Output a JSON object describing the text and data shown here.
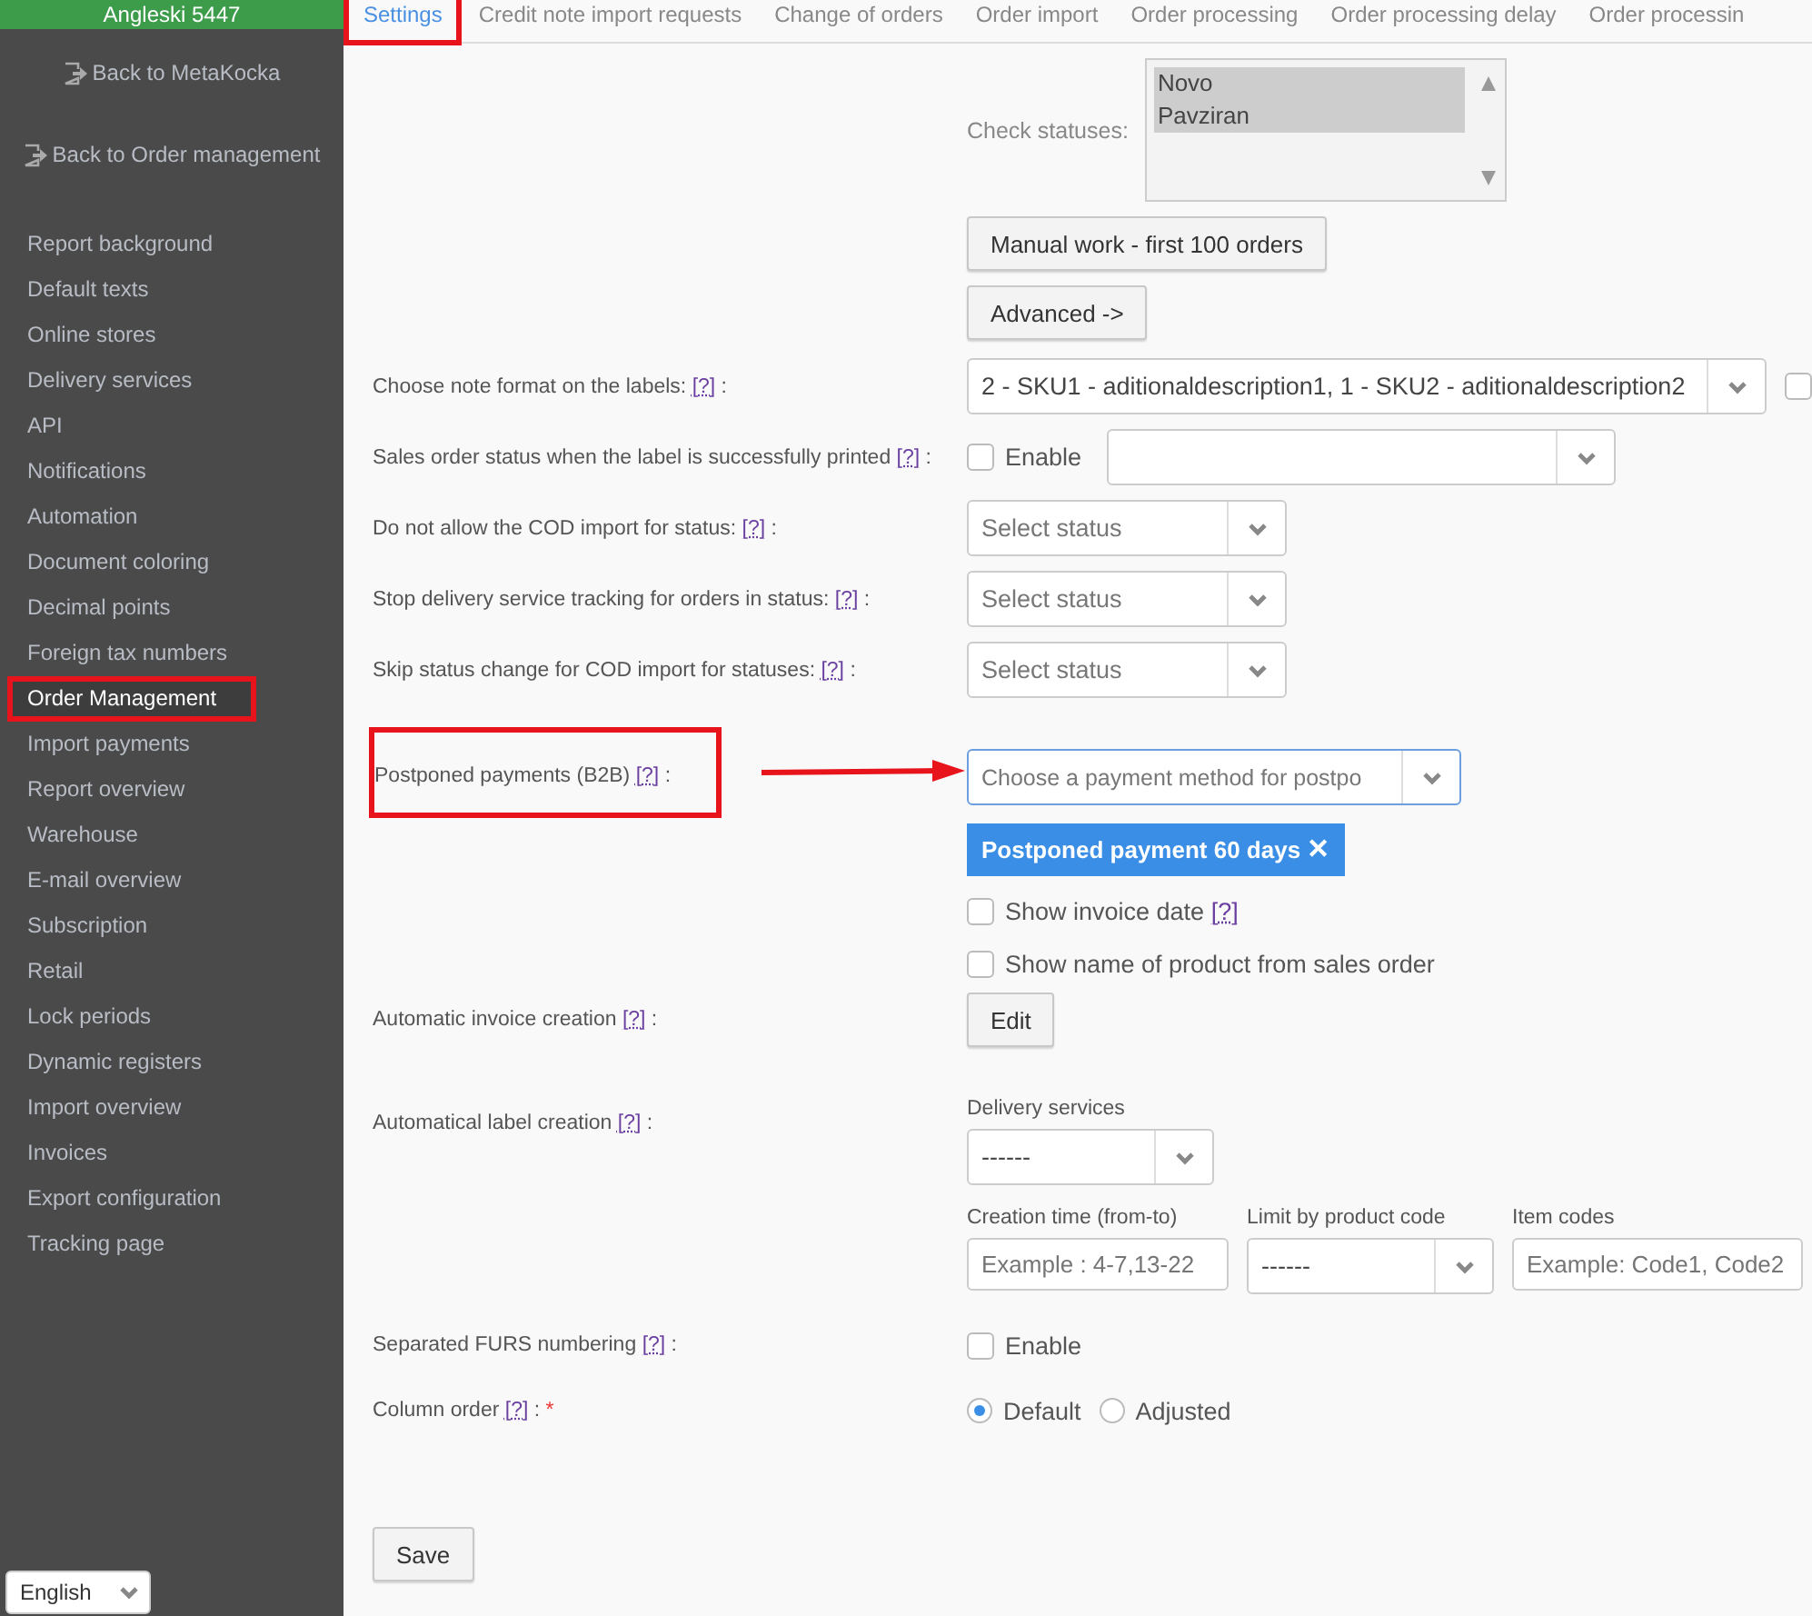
{
  "sidebar": {
    "header": "Angleski 5447",
    "back_links": [
      {
        "label": "Back to MetaKocka"
      },
      {
        "label": "Back to Order management"
      }
    ],
    "items": [
      {
        "label": "Report background",
        "selected": false,
        "highlighted": false
      },
      {
        "label": "Default texts",
        "selected": false,
        "highlighted": false
      },
      {
        "label": "Online stores",
        "selected": false,
        "highlighted": false
      },
      {
        "label": "Delivery services",
        "selected": false,
        "highlighted": false
      },
      {
        "label": "API",
        "selected": false,
        "highlighted": false
      },
      {
        "label": "Notifications",
        "selected": false,
        "highlighted": false
      },
      {
        "label": "Automation",
        "selected": false,
        "highlighted": false
      },
      {
        "label": "Document coloring",
        "selected": false,
        "highlighted": false
      },
      {
        "label": "Decimal points",
        "selected": false,
        "highlighted": false
      },
      {
        "label": "Foreign tax numbers",
        "selected": false,
        "highlighted": false
      },
      {
        "label": "Order Management",
        "selected": true,
        "highlighted": true
      },
      {
        "label": "Import payments",
        "selected": false,
        "highlighted": false
      },
      {
        "label": "Report overview",
        "selected": false,
        "highlighted": false
      },
      {
        "label": "Warehouse",
        "selected": false,
        "highlighted": false
      },
      {
        "label": "E-mail overview",
        "selected": false,
        "highlighted": false
      },
      {
        "label": "Subscription",
        "selected": false,
        "highlighted": false
      },
      {
        "label": "Retail",
        "selected": false,
        "highlighted": false
      },
      {
        "label": "Lock periods",
        "selected": false,
        "highlighted": false
      },
      {
        "label": "Dynamic registers",
        "selected": false,
        "highlighted": false
      },
      {
        "label": "Import overview",
        "selected": false,
        "highlighted": false
      },
      {
        "label": "Invoices",
        "selected": false,
        "highlighted": false
      },
      {
        "label": "Export configuration",
        "selected": false,
        "highlighted": false
      },
      {
        "label": "Tracking page",
        "selected": false,
        "highlighted": false
      }
    ],
    "language": {
      "value": "English"
    }
  },
  "tabs": [
    {
      "label": "Settings",
      "selected": true,
      "highlighted": true
    },
    {
      "label": "Credit note import requests",
      "selected": false,
      "highlighted": false
    },
    {
      "label": "Change of orders",
      "selected": false,
      "highlighted": false
    },
    {
      "label": "Order import",
      "selected": false,
      "highlighted": false
    },
    {
      "label": "Order processing",
      "selected": false,
      "highlighted": false
    },
    {
      "label": "Order processing delay",
      "selected": false,
      "highlighted": false
    },
    {
      "label": "Order processin",
      "selected": false,
      "highlighted": false
    }
  ],
  "form": {
    "check_statuses": {
      "label": "Check statuses:",
      "options": [
        {
          "text": "Novo",
          "selected": true
        },
        {
          "text": "Pavziran",
          "selected": true
        }
      ]
    },
    "top_buttons": [
      {
        "label": "Manual work - first 100 orders"
      },
      {
        "label": "Advanced ->"
      }
    ],
    "rows": [
      {
        "kind": "select",
        "label": "Choose note format on the labels:",
        "help": "[?]",
        "suffix": ":",
        "value": "2 - SKU1 - aditionaldescription1, 1 - SKU2 - aditionaldescription2",
        "wide": true,
        "checkbox": {
          "checked": false
        }
      },
      {
        "kind": "enable_select",
        "label": "Sales order status when the label is successfully printed",
        "help": "[?]",
        "suffix": ":",
        "checkbox": {
          "label": "Enable",
          "checked": false
        }
      },
      {
        "kind": "select",
        "label": "Do not allow the COD import for status:",
        "help": "[?]",
        "suffix": ":",
        "placeholder": "Select status"
      },
      {
        "kind": "select",
        "label": "Stop delivery service tracking for orders in status:",
        "help": "[?]",
        "suffix": ":",
        "placeholder": "Select status"
      },
      {
        "kind": "select",
        "label": "Skip status change for COD import for statuses:",
        "help": "[?]",
        "suffix": ":",
        "placeholder": "Select status"
      },
      {
        "kind": "multiselect",
        "label": "Postponed payments (B2B)",
        "help": "[?]",
        "suffix": ":",
        "highlighted": true,
        "placeholder": "Choose a payment method for postpo",
        "focused": true,
        "tags": [
          {
            "text": "Postponed payment 60 days",
            "remove": "✕"
          }
        ],
        "checkboxes": [
          {
            "label": "Show invoice date",
            "help": "[?]",
            "checked": false
          },
          {
            "label": "Show name of product from sales order",
            "checked": false
          }
        ]
      },
      {
        "kind": "button",
        "label": "Automatic invoice creation",
        "help": "[?]",
        "suffix": ":",
        "button": "Edit"
      },
      {
        "kind": "label_creation",
        "label": "Automatical label creation",
        "help": "[?]",
        "suffix": ":",
        "delivery": {
          "label": "Delivery services",
          "value": "------"
        },
        "fields": [
          {
            "kind": "input",
            "label": "Creation time (from-to)",
            "placeholder": "Example : 4-7,13-22"
          },
          {
            "kind": "select",
            "label": "Limit by product code",
            "value": "------"
          },
          {
            "kind": "input",
            "label": "Item codes",
            "placeholder": "Example: Code1, Code2"
          }
        ]
      },
      {
        "kind": "checkbox",
        "label": "Separated FURS numbering",
        "help": "[?]",
        "suffix": ":",
        "checkbox": {
          "label": "Enable",
          "checked": false
        }
      },
      {
        "kind": "radio",
        "label": "Column order",
        "help": "[?]",
        "suffix": ":",
        "required": "*",
        "options": [
          {
            "label": "Default",
            "selected": true
          },
          {
            "label": "Adjusted",
            "selected": false
          }
        ]
      }
    ],
    "save": "Save"
  }
}
